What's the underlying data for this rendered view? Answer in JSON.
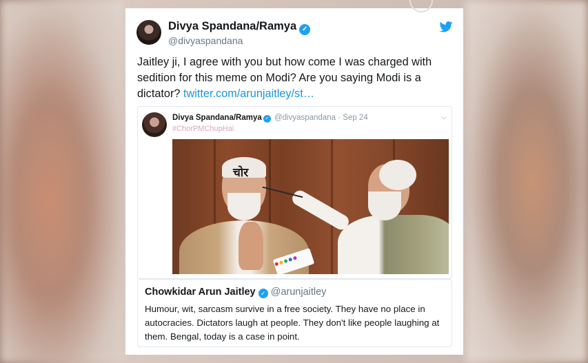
{
  "tweet": {
    "author_name": "Divya Spandana/Ramya",
    "author_handle": "@divyaspandana",
    "text_body": "Jaitley ji, I agree with you but how come I was charged with sedition for this meme on Modi? Are you saying Modi is a dictator? ",
    "link_text": "twitter.com/arunjaitley/st…"
  },
  "quoted_tweet": {
    "author_name": "Divya Spandana/Ramya",
    "author_handle": "@divyaspandana",
    "separator": "·",
    "date": "Sep 24",
    "hashtag": "#ChorPMChupHai",
    "image_text": "चोर"
  },
  "nested_quote": {
    "author_name": "Chowkidar Arun Jaitley",
    "author_handle": "@arunjaitley",
    "text": "Humour, wit, sarcasm survive in a free society. They have no place in autocracies. Dictators laugh at people. They don't like people laughing at them. Bengal, today is a case in point."
  },
  "icons": {
    "verified": "verified-badge-icon",
    "twitter": "twitter-bird-icon",
    "menu": "chevron-down-icon"
  },
  "colors": {
    "verified_blue": "#1da1f2",
    "link_blue": "#1b95e0",
    "handle_gray": "#657786",
    "hashtag_pink": "#e0a3b8"
  }
}
